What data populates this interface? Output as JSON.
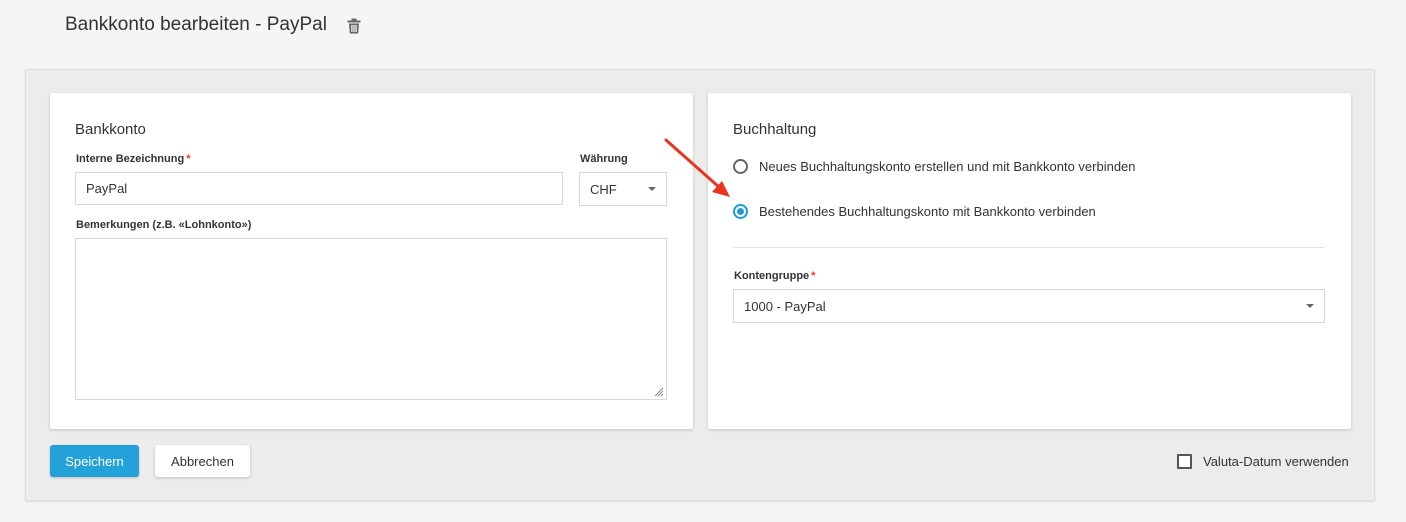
{
  "header": {
    "title": "Bankkonto bearbeiten - PayPal",
    "delete_icon": "trash-icon"
  },
  "bankkonto": {
    "title": "Bankkonto",
    "internal_name_label": "Interne Bezeichnung",
    "internal_name_value": "PayPal",
    "currency_label": "Währung",
    "currency_value": "CHF",
    "remarks_label": "Bemerkungen (z.B. «Lohnkonto»)",
    "remarks_value": ""
  },
  "buchhaltung": {
    "title": "Buchhaltung",
    "options": [
      {
        "label": "Neues Buchhaltungskonto erstellen und mit Bankkonto verbinden",
        "selected": false
      },
      {
        "label": "Bestehendes Buchhaltungskonto mit Bankkonto verbinden",
        "selected": true
      }
    ],
    "account_group_label": "Kontengruppe",
    "account_group_value": "1000 - PayPal"
  },
  "actions": {
    "save_label": "Speichern",
    "cancel_label": "Abbrechen",
    "value_date_label": "Valuta-Datum verwenden",
    "value_date_checked": false
  },
  "colors": {
    "primary": "#22a2d8",
    "radio_selected": "#1e9bd7",
    "required": "#e53935",
    "annotation_arrow": "#e8351d"
  }
}
